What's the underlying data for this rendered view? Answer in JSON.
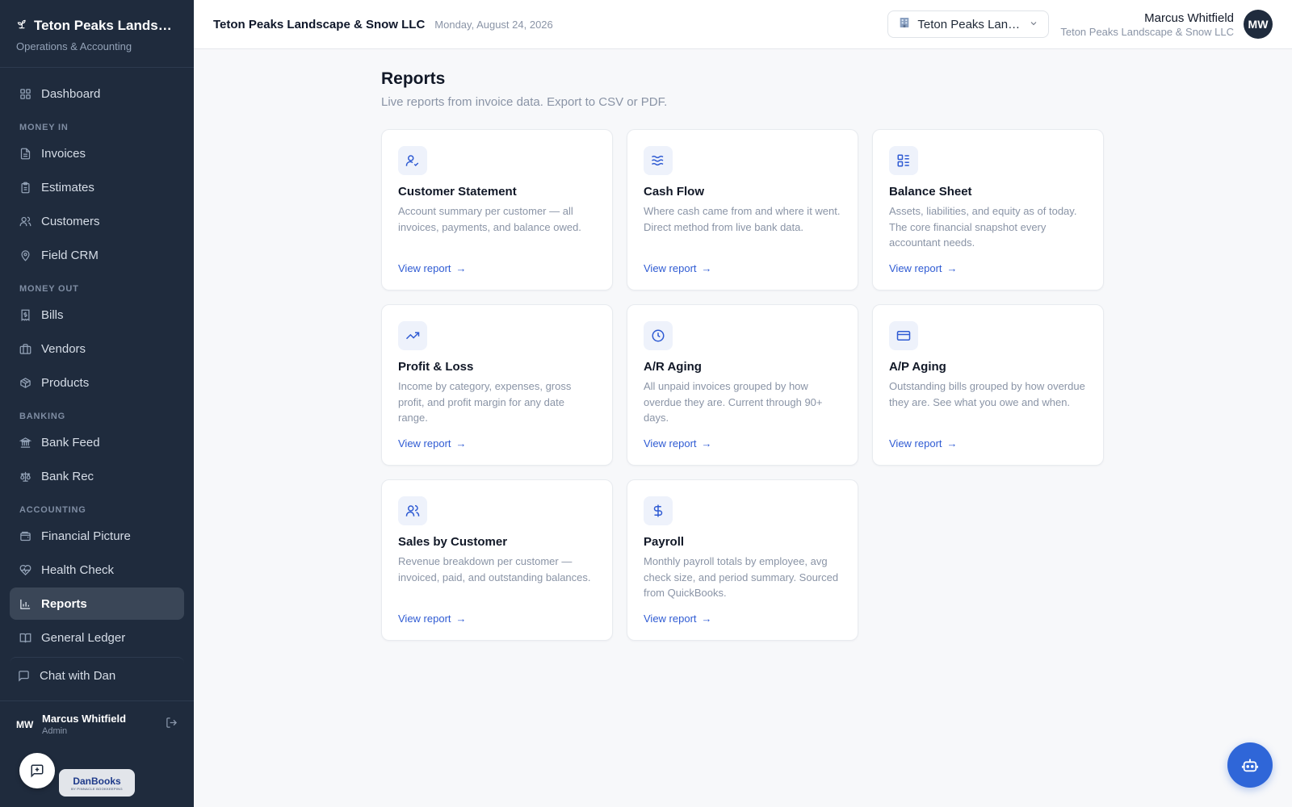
{
  "sidebar": {
    "brand_title": "Teton Peaks Landscape & Snow LLC",
    "brand_sub": "Operations & Accounting",
    "dashboard": "Dashboard",
    "sections": {
      "money_in": "MONEY IN",
      "money_out": "MONEY OUT",
      "banking": "BANKING",
      "accounting": "ACCOUNTING"
    },
    "items": {
      "invoices": "Invoices",
      "estimates": "Estimates",
      "customers": "Customers",
      "field_crm": "Field CRM",
      "bills": "Bills",
      "vendors": "Vendors",
      "products": "Products",
      "bank_feed": "Bank Feed",
      "bank_rec": "Bank Rec",
      "financial_picture": "Financial Picture",
      "health_check": "Health Check",
      "reports": "Reports",
      "general_ledger": "General Ledger",
      "chat": "Chat with Dan"
    },
    "user": {
      "initials": "MW",
      "name": "Marcus Whitfield",
      "role": "Admin"
    },
    "danbooks": {
      "name": "DanBooks",
      "tagline": "BY PINNACLE BOOKKEEPING"
    }
  },
  "header": {
    "company": "Teton Peaks Landscape & Snow LLC",
    "date": "Monday, August 24, 2026",
    "company_select": "Teton Peaks Landscape & Snow LLC",
    "user_name": "Marcus Whitfield",
    "user_company": "Teton Peaks Landscape & Snow LLC",
    "avatar": "MW"
  },
  "page": {
    "title": "Reports",
    "subtitle": "Live reports from invoice data. Export to CSV or PDF.",
    "link_label": "View report",
    "cards": [
      {
        "title": "Customer Statement",
        "desc": "Account summary per customer — all invoices, payments, and balance owed.",
        "icon": "user-check-icon"
      },
      {
        "title": "Cash Flow",
        "desc": "Where cash came from and where it went. Direct method from live bank data.",
        "icon": "waves-icon"
      },
      {
        "title": "Balance Sheet",
        "desc": "Assets, liabilities, and equity as of today. The core financial snapshot every accountant needs.",
        "icon": "layout-list-icon"
      },
      {
        "title": "Profit & Loss",
        "desc": "Income by category, expenses, gross profit, and profit margin for any date range.",
        "icon": "trending-up-icon"
      },
      {
        "title": "A/R Aging",
        "desc": "All unpaid invoices grouped by how overdue they are. Current through 90+ days.",
        "icon": "clock-icon"
      },
      {
        "title": "A/P Aging",
        "desc": "Outstanding bills grouped by how overdue they are. See what you owe and when.",
        "icon": "credit-card-icon"
      },
      {
        "title": "Sales by Customer",
        "desc": "Revenue breakdown per customer — invoiced, paid, and outstanding balances.",
        "icon": "users-icon"
      },
      {
        "title": "Payroll",
        "desc": "Monthly payroll totals by employee, avg check size, and period summary. Sourced from QuickBooks.",
        "icon": "dollar-icon"
      }
    ]
  },
  "colors": {
    "sidebar_bg": "#1f2b3d",
    "accent": "#2f5bd3",
    "fab": "#2f66d8"
  }
}
